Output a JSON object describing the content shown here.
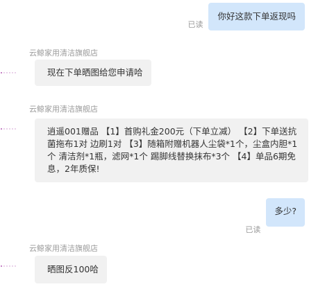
{
  "messages": {
    "m1": {
      "text": "你好这款下单返现吗",
      "status": "已读"
    },
    "m2": {
      "sender": "云鲸家用清洁旗舰店",
      "text": "现在下单晒图给您申请哈"
    },
    "m3": {
      "sender": "云鲸家用清洁旗舰店",
      "text": "逍遥001赠品 【1】首购礼金200元（下单立减）  【2】下单送抗菌拖布1对 边刷1对 【3】随箱附赠机器人尘袋*1个，尘盒内胆*1个 清洁剂*1瓶，滤网*1个 踢脚线替换抹布*3个 【4】单品6期免息，2年质保!"
    },
    "m4": {
      "text": "多少?",
      "status": "已读"
    },
    "m5": {
      "sender": "云鲸家用清洁旗舰店",
      "text": "晒图反100哈"
    }
  },
  "colors": {
    "outgoing_bubble": "#d2e6fb",
    "incoming_bubble": "#f1f1f1",
    "avatar_stub": "#b45bb4"
  }
}
